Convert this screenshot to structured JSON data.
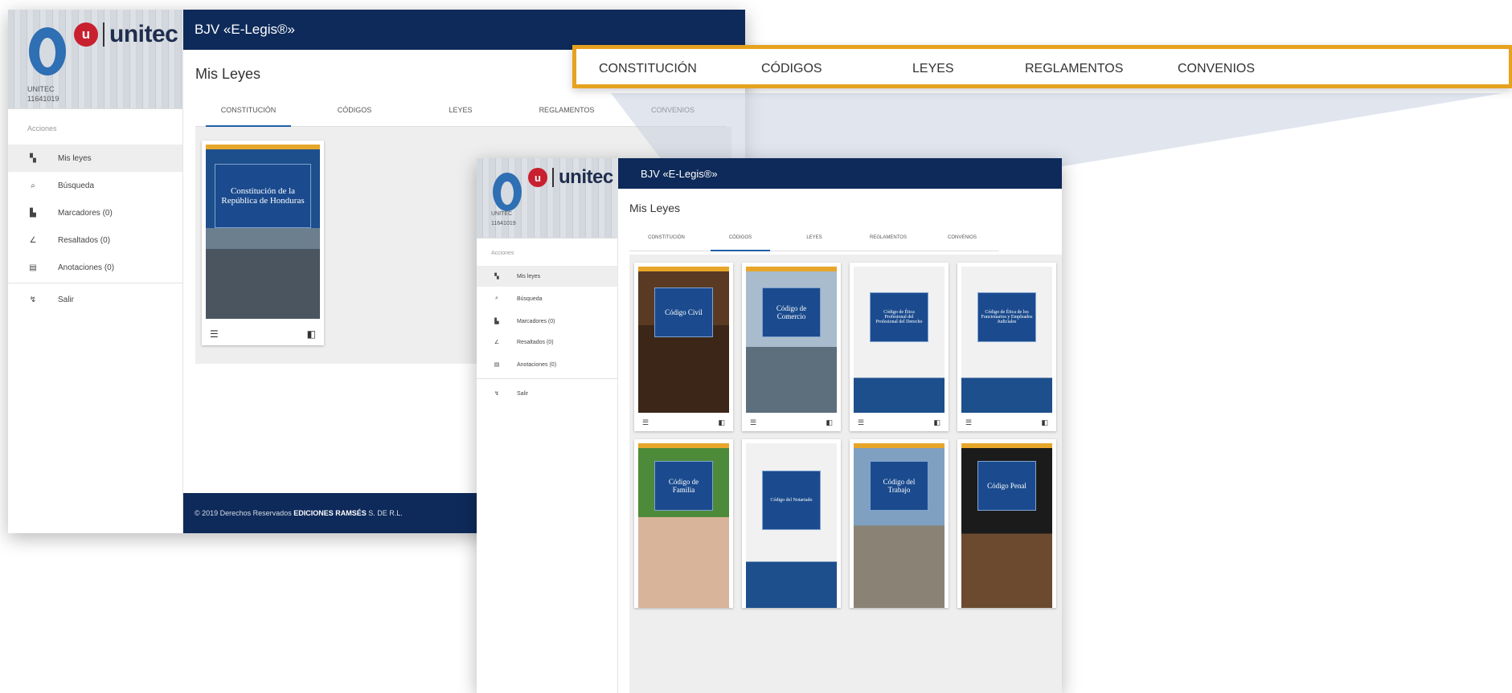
{
  "app_title": "BJV «E-Legis®»",
  "page_title": "Mis Leyes",
  "brand": {
    "badge": "u",
    "name": "unitec"
  },
  "user": {
    "name": "UNITEC",
    "id": "11641019"
  },
  "sidebar": {
    "section_label": "Acciones",
    "items": [
      {
        "label": "Mis leyes",
        "icon": "dashboard-icon"
      },
      {
        "label": "Búsqueda",
        "icon": "search-icon"
      },
      {
        "label": "Marcadores (0)",
        "icon": "bookmarks-icon"
      },
      {
        "label": "Resaltados (0)",
        "icon": "highlighter-icon"
      },
      {
        "label": "Anotaciones (0)",
        "icon": "notes-icon"
      },
      {
        "label": "Salir",
        "icon": "logout-icon"
      }
    ]
  },
  "tabs": [
    "CONSTITUCIÓN",
    "CÓDIGOS",
    "LEYES",
    "REGLAMENTOS",
    "CONVENIOS"
  ],
  "callout_tabs": [
    "CONSTITUCIÓN",
    "CÓDIGOS",
    "LEYES",
    "REGLAMENTOS",
    "CONVENIOS"
  ],
  "constitution_book": {
    "title": "Constitución de la República de Honduras"
  },
  "codigos_books": [
    {
      "title": "Código Civil"
    },
    {
      "title": "Código de Comercio"
    },
    {
      "title": "Código de Ética Profesional del Profesional del Derecho"
    },
    {
      "title": "Código de Ética de los Funcionarios y Empleados Judiciales"
    },
    {
      "title": "Código de Familia"
    },
    {
      "title": "Código del Notariado"
    },
    {
      "title": "Código del Trabajo"
    },
    {
      "title": "Código Penal"
    }
  ],
  "footer": {
    "prefix": "© 2019 Derechos Reservados",
    "company": "EDICIONES RAMSÉS",
    "suffix": "S. DE R.L."
  },
  "colors": {
    "navy": "#0e2a5a",
    "accent_orange": "#e6a21f",
    "brand_red": "#c8202f",
    "cover_blue": "#1b4b8e"
  }
}
